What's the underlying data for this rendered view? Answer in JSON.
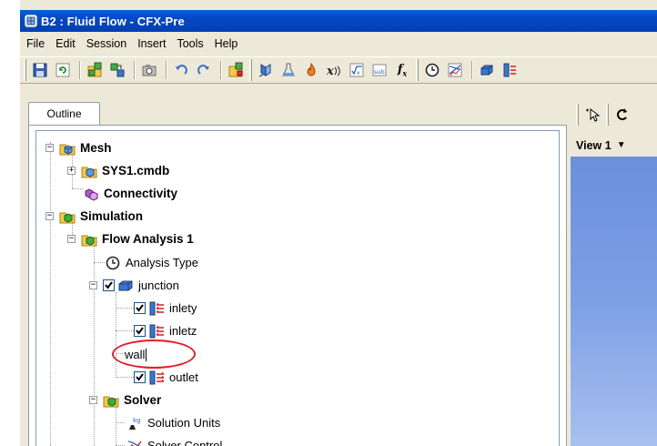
{
  "window": {
    "title": "B2 : Fluid Flow - CFX-Pre"
  },
  "menu": [
    "File",
    "Edit",
    "Session",
    "Insert",
    "Tools",
    "Help"
  ],
  "tabs": {
    "outline": "Outline"
  },
  "view": {
    "label": "View 1"
  },
  "tree": {
    "mesh": "Mesh",
    "sys1": "SYS1.cmdb",
    "connectivity": "Connectivity",
    "simulation": "Simulation",
    "flow_analysis": "Flow Analysis 1",
    "analysis_type": "Analysis Type",
    "junction": "junction",
    "inlety": "inlety",
    "inletz": "inletz",
    "wall_edit": "wall",
    "outlet": "outlet",
    "solver": "Solver",
    "solution_units": "Solution Units",
    "solver_control": "Solver Control"
  },
  "icons": {
    "toolbar": [
      "save-icon",
      "refresh-icon",
      "mesh-import-icon",
      "mesh-transform-icon",
      "camera-icon",
      "undo-icon",
      "redo-icon",
      "new-icon",
      "domain-icon",
      "material-icon",
      "reaction-icon",
      "additional-variable-icon",
      "expression-icon",
      "user-routine-icon",
      "function-icon",
      "clock-icon",
      "solver-icon",
      "box-icon",
      "boundary-icon"
    ],
    "annotation_color": "#e0202a"
  }
}
